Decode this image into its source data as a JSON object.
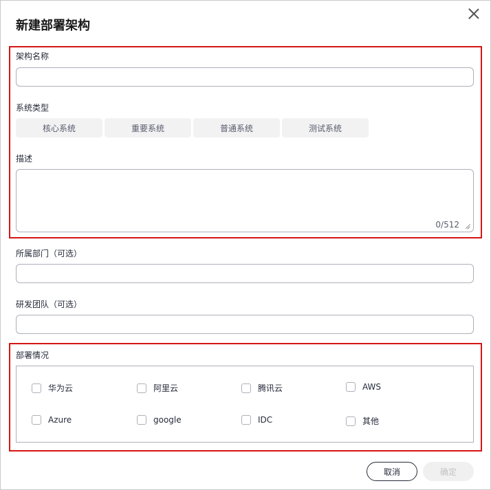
{
  "dialog": {
    "title": "新建部署架构"
  },
  "form": {
    "name_label": "架构名称",
    "name_value": "",
    "type_label": "系统类型",
    "types": [
      "核心系统",
      "重要系统",
      "普通系统",
      "测试系统"
    ],
    "desc_label": "描述",
    "desc_counter": "0/512",
    "dept_label": "所属部门（可选）",
    "team_label": "研发团队（可选）",
    "deploy_label": "部署情况",
    "deploy_options": [
      "华为云",
      "阿里云",
      "腾讯云",
      "AWS",
      "Azure",
      "google",
      "IDC",
      "其他"
    ]
  },
  "footer": {
    "cancel_label": "取消",
    "ok_label": "确定"
  },
  "colors": {
    "highlight": "#d61414",
    "border": "#adb0b8",
    "segment_bg": "#f2f2f3"
  }
}
